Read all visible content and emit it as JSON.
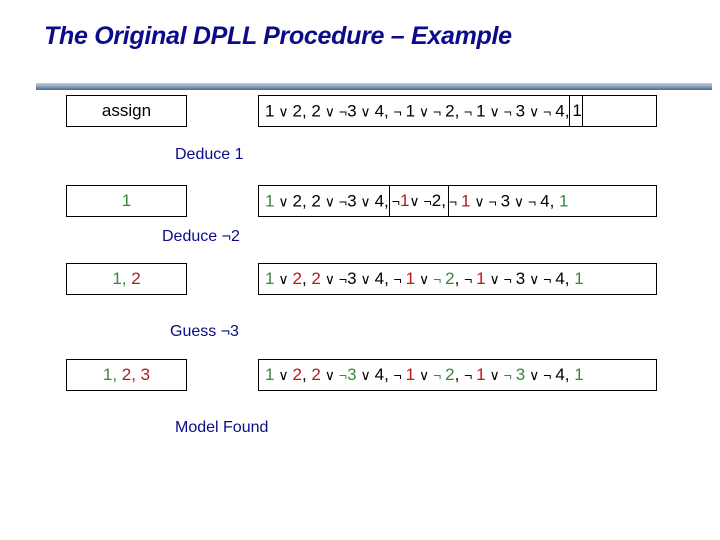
{
  "title": "The Original DPLL Procedure – Example",
  "colors": {
    "title": "#0b0b8a",
    "step_label": "#0b0b8a",
    "true_literal": "#3a8a3a",
    "false_literal": "#b01c1c",
    "unassigned": "#000000"
  },
  "rows": [
    {
      "assignment": [
        {
          "text": "assign",
          "color": "black"
        }
      ],
      "formula": [
        {
          "text": "1",
          "color": "black"
        },
        {
          "text": " ∨ ",
          "color": "black",
          "sym": true
        },
        {
          "text": "2, 2",
          "color": "black"
        },
        {
          "text": " ∨ ",
          "color": "black",
          "sym": true
        },
        {
          "text": "¬",
          "color": "black",
          "sym": true
        },
        {
          "text": "3",
          "color": "black"
        },
        {
          "text": " ∨ ",
          "color": "black",
          "sym": true
        },
        {
          "text": "4, ",
          "color": "black"
        },
        {
          "text": "¬ ",
          "color": "black",
          "sym": true
        },
        {
          "text": "1",
          "color": "black"
        },
        {
          "text": " ∨ ¬ ",
          "color": "black",
          "sym": true
        },
        {
          "text": "2, ",
          "color": "black"
        },
        {
          "text": "¬ ",
          "color": "black",
          "sym": true
        },
        {
          "text": "1",
          "color": "black"
        },
        {
          "text": " ∨ ¬ ",
          "color": "black",
          "sym": true
        },
        {
          "text": "3",
          "color": "black"
        },
        {
          "text": " ∨ ¬ ",
          "color": "black",
          "sym": true
        },
        {
          "text": "4,",
          "color": "black"
        },
        {
          "text": "1",
          "color": "black",
          "boxed": true
        }
      ]
    },
    {
      "step_label": "Deduce 1",
      "assignment": [
        {
          "text": "1",
          "color": "green"
        }
      ],
      "formula": [
        {
          "text": "1",
          "color": "green"
        },
        {
          "text": " ∨ ",
          "color": "black",
          "sym": true
        },
        {
          "text": "2, 2",
          "color": "black"
        },
        {
          "text": " ∨ ",
          "color": "black",
          "sym": true
        },
        {
          "text": "¬",
          "color": "black",
          "sym": true
        },
        {
          "text": "3",
          "color": "black"
        },
        {
          "text": " ∨ ",
          "color": "black",
          "sym": true
        },
        {
          "text": "4,",
          "color": "black"
        },
        {
          "text": "¬ ",
          "color": "black",
          "sym": true,
          "boxstart": true
        },
        {
          "text": "1",
          "color": "red"
        },
        {
          "text": " ∨ ¬ ",
          "color": "black",
          "sym": true
        },
        {
          "text": "2,",
          "color": "black",
          "boxend": true
        },
        {
          "text": "¬ ",
          "color": "black",
          "sym": true
        },
        {
          "text": "1",
          "color": "red"
        },
        {
          "text": " ∨ ¬ ",
          "color": "black",
          "sym": true
        },
        {
          "text": "3",
          "color": "black"
        },
        {
          "text": " ∨ ¬ ",
          "color": "black",
          "sym": true
        },
        {
          "text": "4, ",
          "color": "black"
        },
        {
          "text": "1",
          "color": "green"
        }
      ]
    },
    {
      "step_label": "Deduce ¬2",
      "assignment": [
        {
          "text": "1, ",
          "color": "green"
        },
        {
          "text": "2",
          "color": "red"
        }
      ],
      "formula": [
        {
          "text": "1",
          "color": "green"
        },
        {
          "text": " ∨ ",
          "color": "black",
          "sym": true
        },
        {
          "text": "2",
          "color": "red"
        },
        {
          "text": ", ",
          "color": "black"
        },
        {
          "text": "2",
          "color": "red"
        },
        {
          "text": " ∨ ",
          "color": "black",
          "sym": true
        },
        {
          "text": "¬",
          "color": "black",
          "sym": true
        },
        {
          "text": "3",
          "color": "black"
        },
        {
          "text": " ∨ ",
          "color": "black",
          "sym": true
        },
        {
          "text": "4, ",
          "color": "black"
        },
        {
          "text": "¬ ",
          "color": "black",
          "sym": true
        },
        {
          "text": "1",
          "color": "red"
        },
        {
          "text": " ∨ ",
          "color": "black",
          "sym": true
        },
        {
          "text": "¬ ",
          "color": "green",
          "sym": true
        },
        {
          "text": "2",
          "color": "green"
        },
        {
          "text": ", ",
          "color": "black"
        },
        {
          "text": "¬ ",
          "color": "black",
          "sym": true
        },
        {
          "text": "1",
          "color": "red"
        },
        {
          "text": " ∨ ¬ ",
          "color": "black",
          "sym": true
        },
        {
          "text": "3",
          "color": "black"
        },
        {
          "text": " ∨ ¬ ",
          "color": "black",
          "sym": true
        },
        {
          "text": "4, ",
          "color": "black"
        },
        {
          "text": "1",
          "color": "green"
        }
      ]
    },
    {
      "step_label": "Guess ¬3",
      "assignment": [
        {
          "text": "1, ",
          "color": "green"
        },
        {
          "text": "2, 3",
          "color": "red"
        }
      ],
      "formula": [
        {
          "text": "1",
          "color": "green"
        },
        {
          "text": " ∨ ",
          "color": "black",
          "sym": true
        },
        {
          "text": "2",
          "color": "red"
        },
        {
          "text": ", ",
          "color": "black"
        },
        {
          "text": "2",
          "color": "red"
        },
        {
          "text": " ∨ ",
          "color": "black",
          "sym": true
        },
        {
          "text": "¬",
          "color": "green",
          "sym": true
        },
        {
          "text": "3",
          "color": "green"
        },
        {
          "text": " ∨ ",
          "color": "black",
          "sym": true
        },
        {
          "text": "4, ",
          "color": "black"
        },
        {
          "text": "¬ ",
          "color": "black",
          "sym": true
        },
        {
          "text": "1",
          "color": "red"
        },
        {
          "text": " ∨ ",
          "color": "black",
          "sym": true
        },
        {
          "text": "¬ ",
          "color": "green",
          "sym": true
        },
        {
          "text": "2",
          "color": "green"
        },
        {
          "text": ", ",
          "color": "black"
        },
        {
          "text": "¬ ",
          "color": "black",
          "sym": true
        },
        {
          "text": "1",
          "color": "red"
        },
        {
          "text": " ∨ ",
          "color": "black",
          "sym": true
        },
        {
          "text": "¬ ",
          "color": "green",
          "sym": true
        },
        {
          "text": "3",
          "color": "green"
        },
        {
          "text": " ∨ ¬ ",
          "color": "black",
          "sym": true
        },
        {
          "text": "4, ",
          "color": "black"
        },
        {
          "text": "1",
          "color": "green"
        }
      ]
    }
  ],
  "final_label": "Model Found"
}
